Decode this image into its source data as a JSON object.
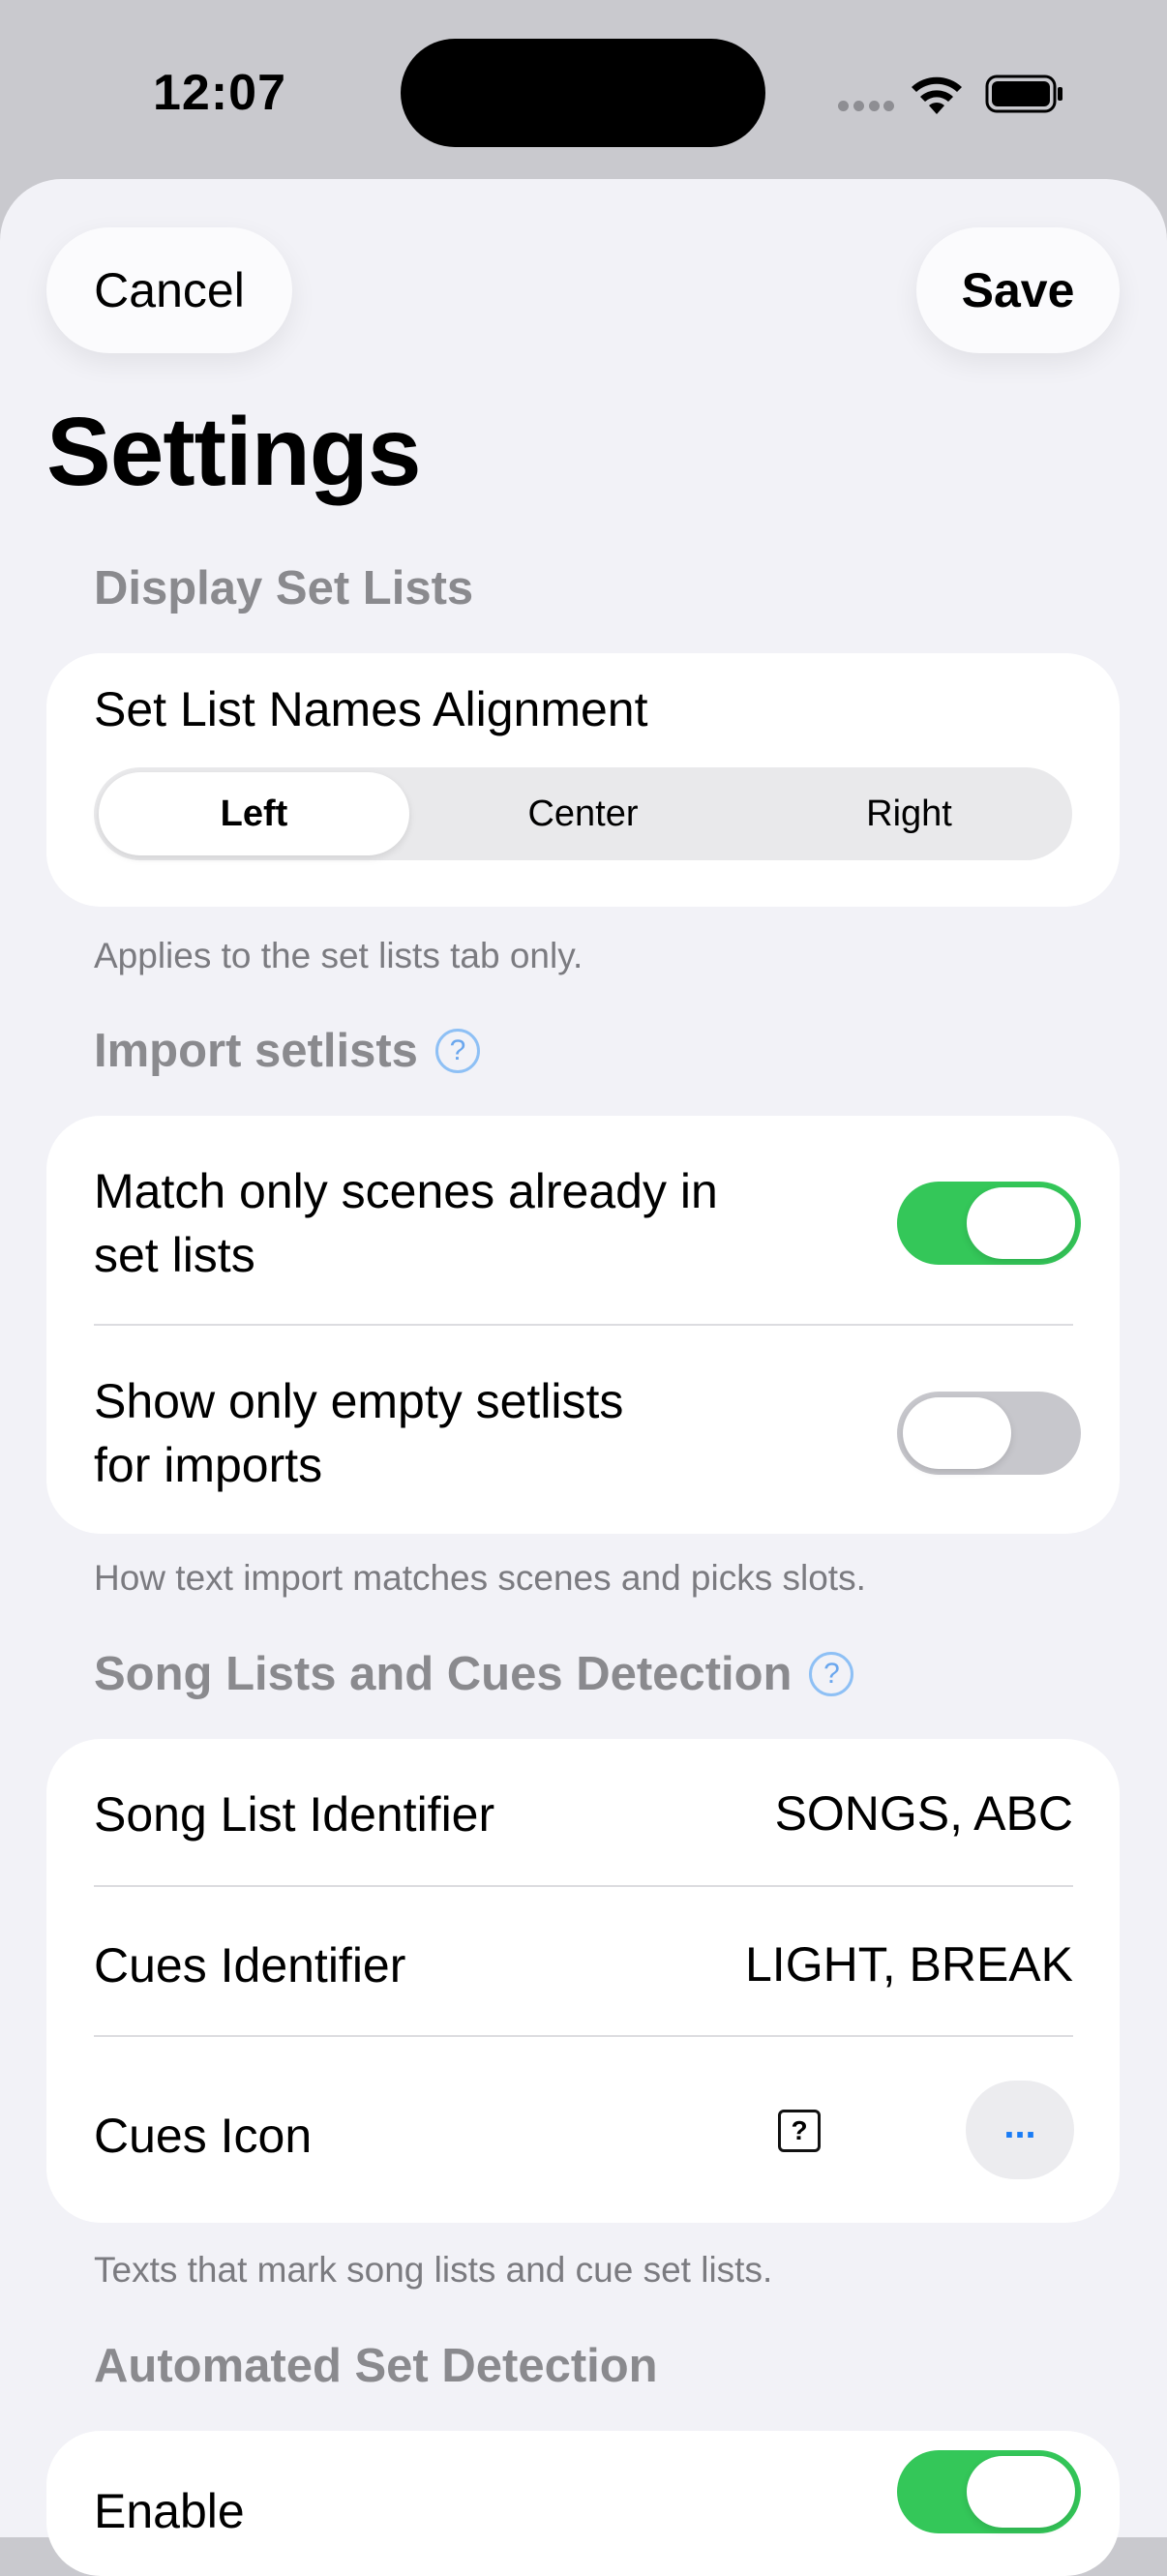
{
  "status_bar": {
    "time": "12:07"
  },
  "toolbar": {
    "cancel_label": "Cancel",
    "save_label": "Save"
  },
  "page_title": "Settings",
  "display_section": {
    "header": "Display Set Lists",
    "alignment_label": "Set List Names Alignment",
    "options": [
      "Left",
      "Center",
      "Right"
    ],
    "selected": "Left",
    "footer": "Applies to the set lists tab only."
  },
  "import_section": {
    "header": "Import setlists",
    "help_icon": "?",
    "match_label_line1": "Match only scenes already in",
    "match_label_line2": "set lists",
    "match_on": true,
    "empty_label_line1": "Show only empty setlists",
    "empty_label_line2": "for imports",
    "empty_on": false,
    "footer": "How text import matches scenes and picks slots."
  },
  "detection_section": {
    "header": "Song Lists and Cues Detection",
    "help_icon": "?",
    "song_list_label": "Song List Identifier",
    "song_list_value": "SONGS, ABC",
    "cues_label": "Cues Identifier",
    "cues_value": "LIGHT, BREAK",
    "cues_icon_label": "Cues Icon",
    "cues_icon_glyph": "?",
    "more_button": "...",
    "footer": "Texts that mark song lists and cue set lists."
  },
  "auto_section": {
    "header": "Automated Set Detection",
    "enable_label": "Enable",
    "enable_on": true
  },
  "colors": {
    "accent": "#34c759",
    "link": "#1a7cf5",
    "help": "#6ba7ee"
  }
}
